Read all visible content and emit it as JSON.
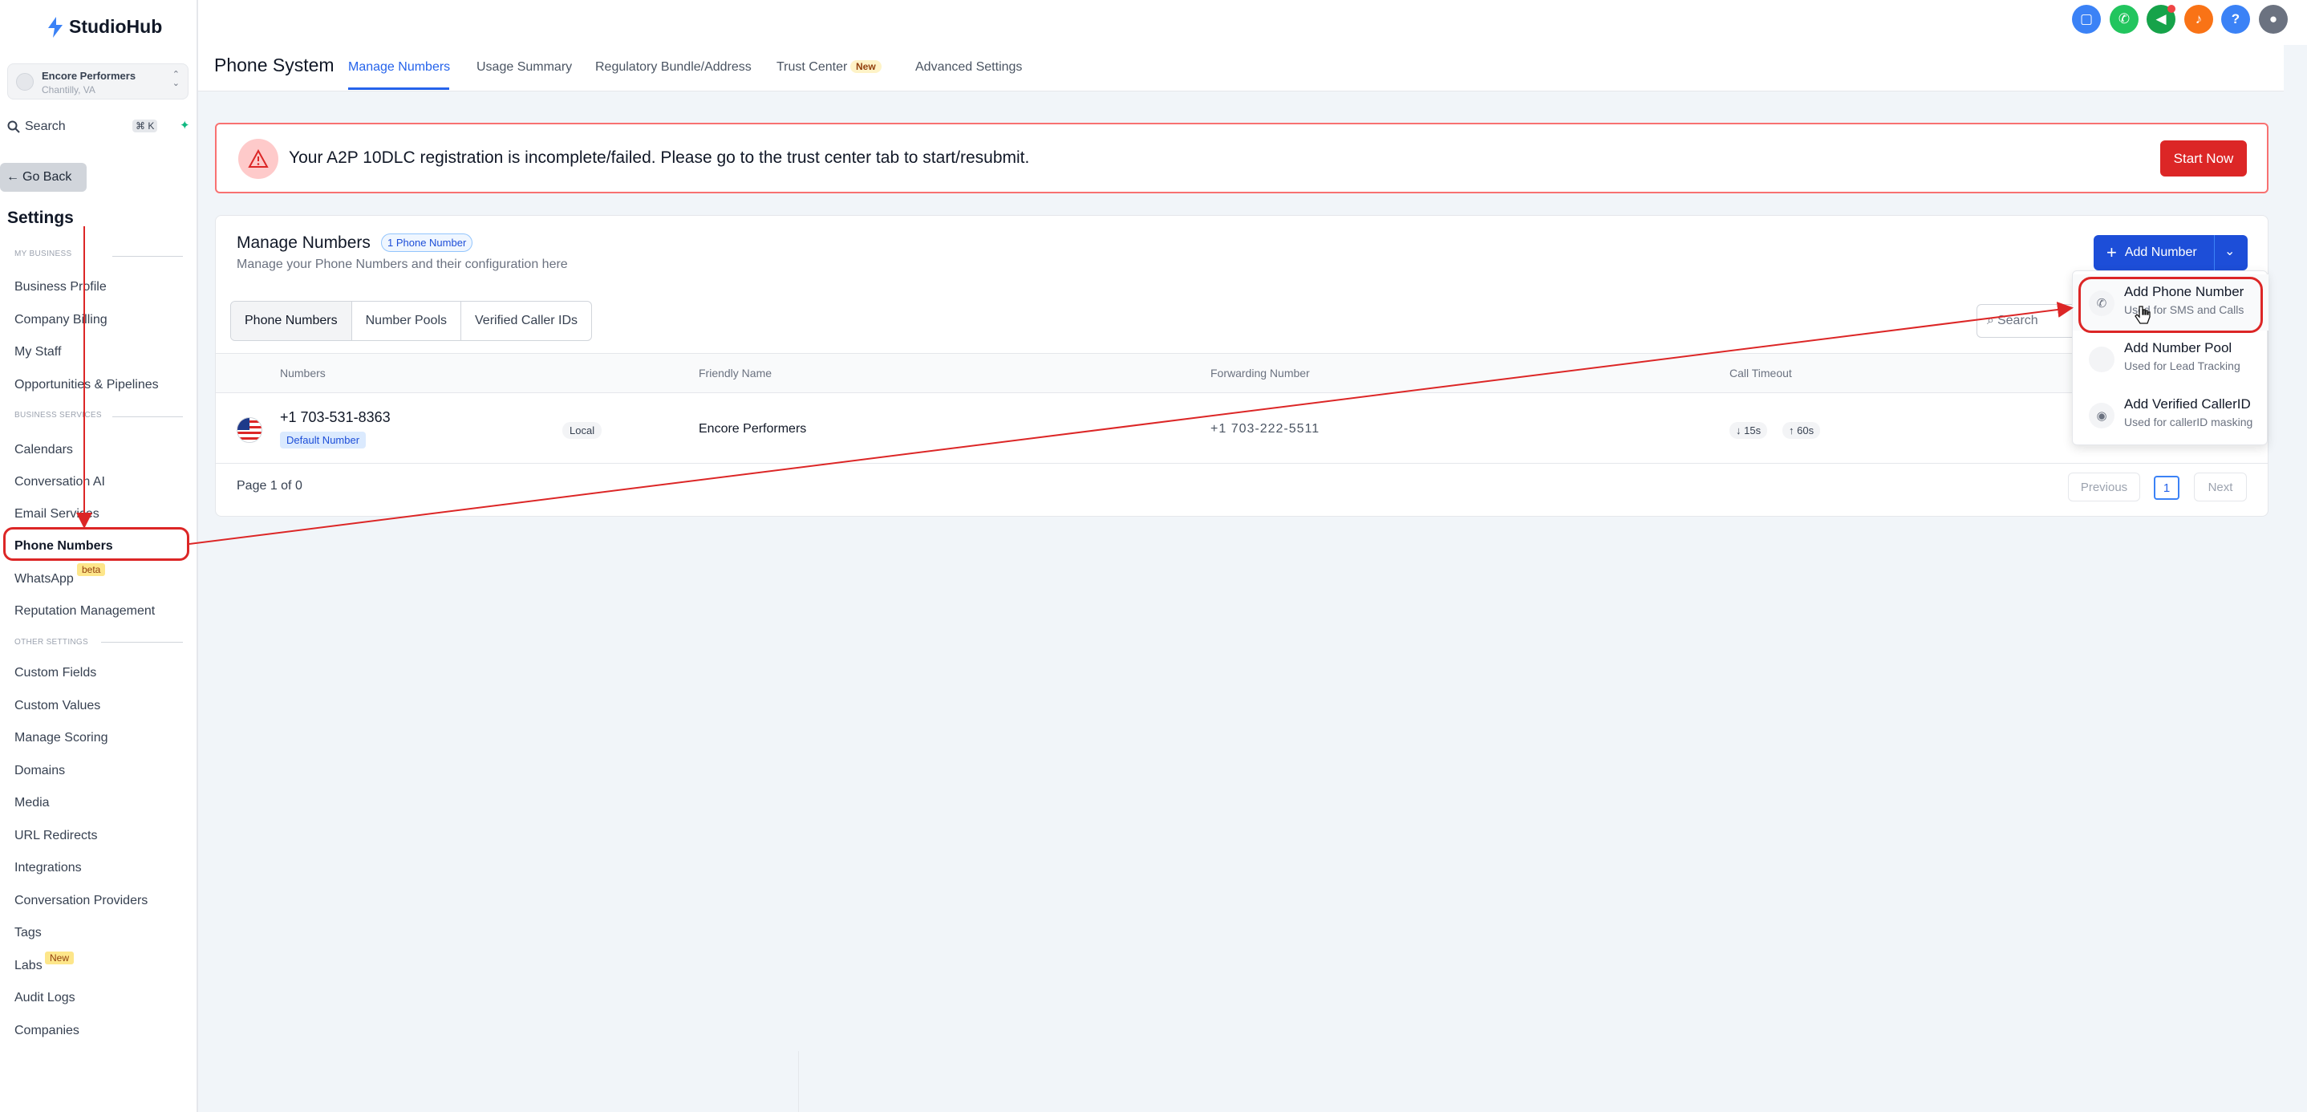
{
  "brand": {
    "name": "StudioHub"
  },
  "account": {
    "name": "Encore Performers",
    "location": "Chantilly, VA"
  },
  "sidebar": {
    "search_label": "Search",
    "search_shortcut": "⌘ K",
    "go_back": "Go Back",
    "settings_title": "Settings",
    "sections": [
      {
        "label": "MY BUSINESS"
      },
      {
        "label": "BUSINESS SERVICES"
      },
      {
        "label": "OTHER SETTINGS"
      }
    ],
    "items": [
      {
        "label": "Business Profile"
      },
      {
        "label": "Company Billing"
      },
      {
        "label": "My Staff"
      },
      {
        "label": "Opportunities & Pipelines"
      },
      {
        "label": "Calendars"
      },
      {
        "label": "Conversation AI"
      },
      {
        "label": "Email Services"
      },
      {
        "label": "Phone Numbers",
        "active": true
      },
      {
        "label": "WhatsApp",
        "badge": "beta"
      },
      {
        "label": "Reputation Management"
      },
      {
        "label": "Custom Fields"
      },
      {
        "label": "Custom Values"
      },
      {
        "label": "Manage Scoring"
      },
      {
        "label": "Domains"
      },
      {
        "label": "Media"
      },
      {
        "label": "URL Redirects"
      },
      {
        "label": "Integrations"
      },
      {
        "label": "Conversation Providers"
      },
      {
        "label": "Tags"
      },
      {
        "label": "Labs",
        "badge": "New"
      },
      {
        "label": "Audit Logs"
      },
      {
        "label": "Companies"
      }
    ]
  },
  "topbar": {
    "icons": [
      {
        "name": "chat-icon",
        "color": "#3b82f6"
      },
      {
        "name": "phone-icon",
        "color": "#22c55e"
      },
      {
        "name": "megaphone-icon",
        "color": "#16a34a"
      },
      {
        "name": "bell-icon",
        "color": "#f97316"
      },
      {
        "name": "help-icon",
        "color": "#3b82f6",
        "glyph": "?"
      }
    ]
  },
  "header": {
    "title": "Phone System",
    "tabs": [
      {
        "label": "Manage Numbers",
        "active": true
      },
      {
        "label": "Usage Summary"
      },
      {
        "label": "Regulatory Bundle/Address"
      },
      {
        "label": "Trust Center",
        "badge": "New"
      },
      {
        "label": "Advanced Settings"
      }
    ]
  },
  "alert": {
    "message": "Your A2P 10DLC registration is incomplete/failed. Please go to the trust center tab to start/resubmit.",
    "button": "Start Now"
  },
  "manage": {
    "title": "Manage Numbers",
    "count_pill": "1 Phone Number",
    "subtitle": "Manage your Phone Numbers and their configuration here",
    "add_button": "Add Number",
    "tabs": [
      {
        "label": "Phone Numbers",
        "active": true
      },
      {
        "label": "Number Pools"
      },
      {
        "label": "Verified Caller IDs"
      }
    ],
    "search_placeholder": "Search",
    "columns": [
      "Numbers",
      "Friendly Name",
      "Forwarding Number",
      "Call Timeout"
    ],
    "rows": [
      {
        "number": "+1 703-531-8363",
        "default_badge": "Default Number",
        "type": "Local",
        "friendly_name": "Encore Performers",
        "forwarding": "+1 703-222-5511",
        "timeout_down": "↓ 15s",
        "timeout_up": "↑ 60s"
      }
    ],
    "pagination": {
      "page_of": "Page 1 of 0",
      "previous": "Previous",
      "current": "1",
      "next": "Next"
    }
  },
  "dropdown": {
    "items": [
      {
        "title": "Add Phone Number",
        "subtitle": "Used for SMS and Calls"
      },
      {
        "title": "Add Number Pool",
        "subtitle": "Used for Lead Tracking"
      },
      {
        "title": "Add Verified CallerID",
        "subtitle": "Used for callerID masking"
      }
    ]
  },
  "colors": {
    "primary": "#1d4ed8",
    "danger": "#dc2626",
    "annotation": "#dc2626"
  }
}
